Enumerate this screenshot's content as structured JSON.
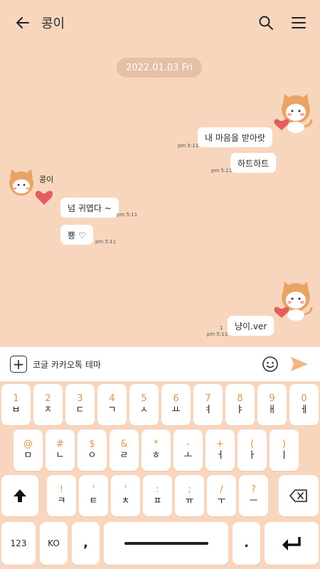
{
  "header": {
    "title": "콩이",
    "back_icon": "arrow-left-icon",
    "search_icon": "search-icon",
    "menu_icon": "hamburger-menu-icon"
  },
  "chat": {
    "date": "2022.01.03 Fri",
    "messages": [
      {
        "side": "right",
        "text": "내 마음을 받아랏",
        "time": "pm 5:11"
      },
      {
        "side": "right",
        "text": "하트하트",
        "time": "pm 5:11"
      },
      {
        "side": "left",
        "sender": "콩이",
        "text": "넘 귀엽다 ~",
        "time": "pm 5:11"
      },
      {
        "side": "left",
        "text": "뿅 ♡",
        "time": "pm 5:11"
      },
      {
        "side": "right",
        "text": "냥이.ver",
        "time": "pm 5:11",
        "unread": "1"
      }
    ]
  },
  "input": {
    "text": "코글 카카오톡 테마",
    "plus_label": "+",
    "emoji_icon": "smiley-icon",
    "send_icon": "send-arrow-icon"
  },
  "keyboard": {
    "row1": [
      {
        "top": "1",
        "main": "ㅂ"
      },
      {
        "top": "2",
        "main": "ㅈ"
      },
      {
        "top": "3",
        "main": "ㄷ"
      },
      {
        "top": "4",
        "main": "ㄱ"
      },
      {
        "top": "5",
        "main": "ㅅ"
      },
      {
        "top": "6",
        "main": "ㅛ"
      },
      {
        "top": "7",
        "main": "ㅕ"
      },
      {
        "top": "8",
        "main": "ㅑ"
      },
      {
        "top": "9",
        "main": "ㅐ"
      },
      {
        "top": "0",
        "main": "ㅔ"
      }
    ],
    "row2": [
      {
        "top": "@",
        "main": "ㅁ"
      },
      {
        "top": "#",
        "main": "ㄴ"
      },
      {
        "top": "$",
        "main": "ㅇ"
      },
      {
        "top": "&",
        "main": "ㄹ"
      },
      {
        "top": "*",
        "main": "ㅎ"
      },
      {
        "top": "-",
        "main": "ㅗ"
      },
      {
        "top": "+",
        "main": "ㅓ"
      },
      {
        "top": "(",
        "main": "ㅏ"
      },
      {
        "top": ")",
        "main": "ㅣ"
      }
    ],
    "row3": [
      {
        "top": "!",
        "main": "ㅋ"
      },
      {
        "top": "'",
        "main": "ㅌ"
      },
      {
        "top": "'",
        "main": "ㅊ"
      },
      {
        "top": ":",
        "main": "ㅍ"
      },
      {
        "top": ";",
        "main": "ㅠ"
      },
      {
        "top": "/",
        "main": "ㅜ"
      },
      {
        "top": "?",
        "main": "ㅡ"
      }
    ],
    "shift_icon": "shift-arrow-icon",
    "backspace_icon": "backspace-icon",
    "num_label": "123",
    "lang_label": "KO",
    "comma_label": ",",
    "period_label": ".",
    "enter_icon": "enter-icon"
  },
  "colors": {
    "background": "#f8d6bd",
    "accent": "#e0924a",
    "date_pill": "#e6c0a6",
    "bubble": "#ffffff"
  }
}
